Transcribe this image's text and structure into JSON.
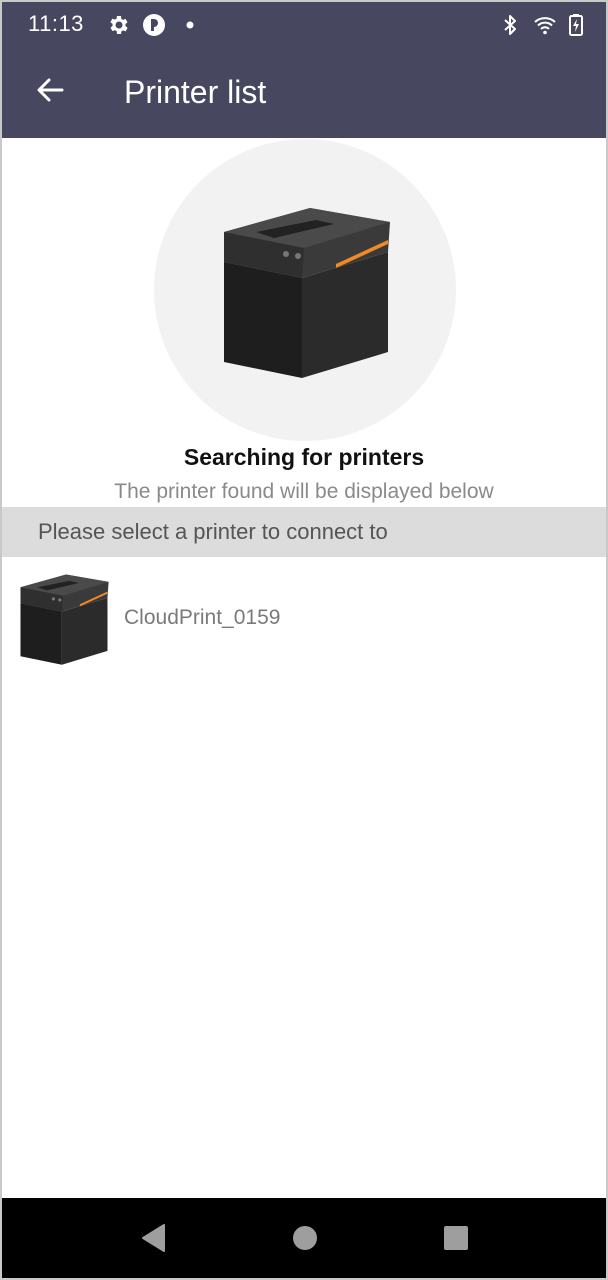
{
  "status_bar": {
    "time": "11:13",
    "icons": [
      "gear-icon",
      "app-notification-icon",
      "dot-icon",
      "bluetooth-icon",
      "wifi-icon",
      "battery-charging-icon"
    ]
  },
  "app_bar": {
    "title": "Printer list",
    "back_icon": "arrow-left-icon"
  },
  "search": {
    "title": "Searching for printers",
    "subtitle": "The printer found will be displayed below"
  },
  "section": {
    "header": "Please select a printer to connect to"
  },
  "printers": [
    {
      "name": "CloudPrint_0159",
      "icon": "printer-image"
    }
  ],
  "nav": {
    "buttons": [
      "back-triangle-icon",
      "home-circle-icon",
      "recents-square-icon"
    ]
  },
  "colors": {
    "bar": "#474760",
    "accent_printer": "#f08a24",
    "section_bg": "#dcdcdc"
  }
}
